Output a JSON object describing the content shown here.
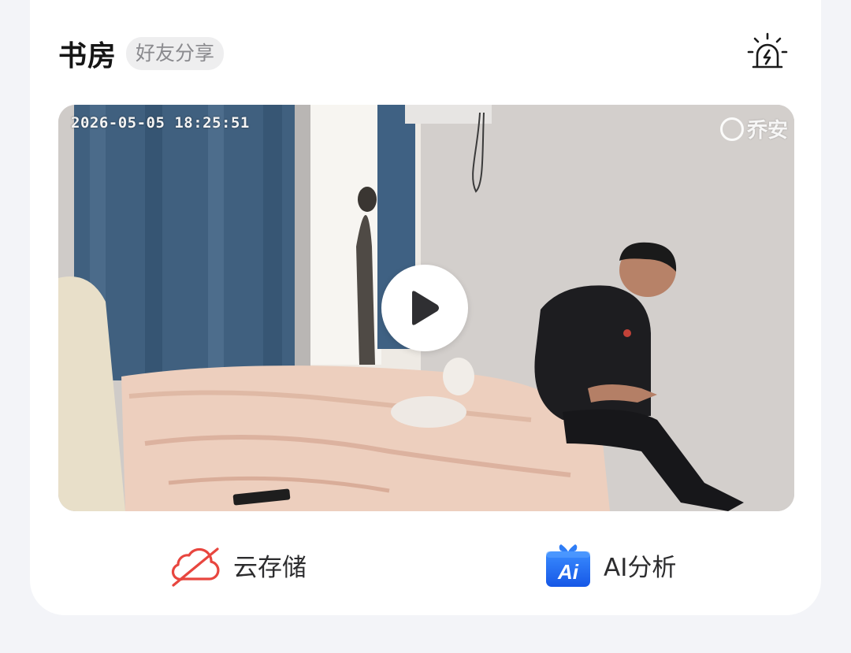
{
  "header": {
    "room_name": "书房",
    "share_badge": "好友分享"
  },
  "video": {
    "timestamp": "2026-05-05  18:25:51",
    "watermark": "乔安"
  },
  "actions": {
    "cloud_storage_label": "云存储",
    "ai_analysis_label": "AI分析",
    "ai_icon_text": "Ai"
  },
  "colors": {
    "card_bg": "#ffffff",
    "page_bg": "#f3f4f8",
    "cloud_disabled_red": "#e8463f",
    "ai_blue": "#1e6ff2"
  }
}
